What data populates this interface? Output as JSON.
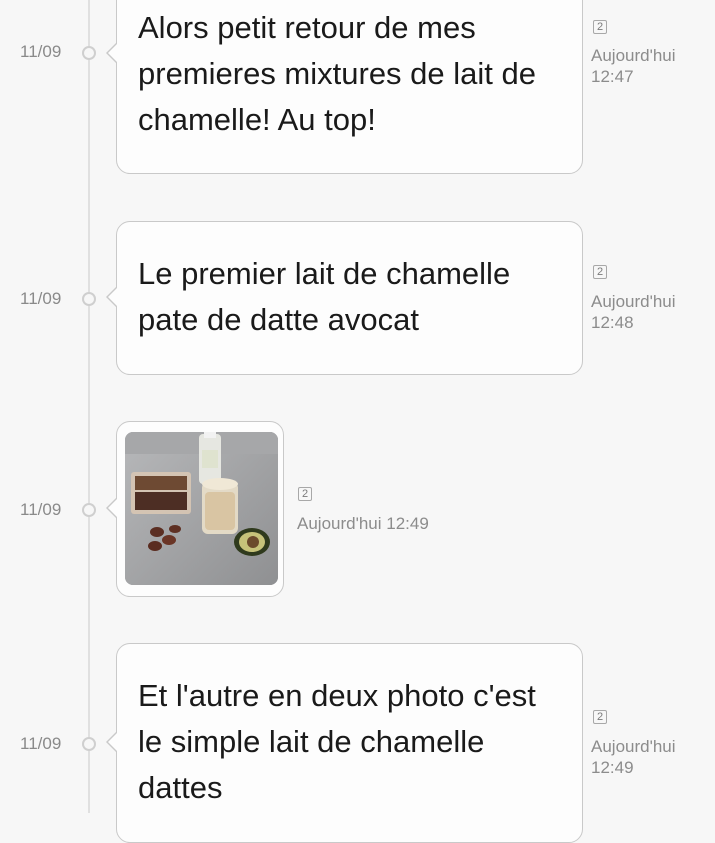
{
  "messages": [
    {
      "date": "11/09",
      "text": "Alors petit retour de mes premieres mixtures de lait de chamelle! Au top!",
      "unread_count": "2",
      "time_label": "Aujourd'hui",
      "time": "12:47"
    },
    {
      "date": "11/09",
      "text": "Le premier lait de chamelle pate de datte avocat",
      "unread_count": "2",
      "time_label": "Aujourd'hui",
      "time": "12:48"
    },
    {
      "date": "11/09",
      "image": "photo-dates-avocado-camel-milk",
      "unread_count": "2",
      "timestamp": "Aujourd'hui 12:49"
    },
    {
      "date": "11/09",
      "text": "Et l'autre en deux photo c'est le simple lait de chamelle dattes",
      "unread_count": "2",
      "time_label": "Aujourd'hui",
      "time": "12:49"
    }
  ]
}
